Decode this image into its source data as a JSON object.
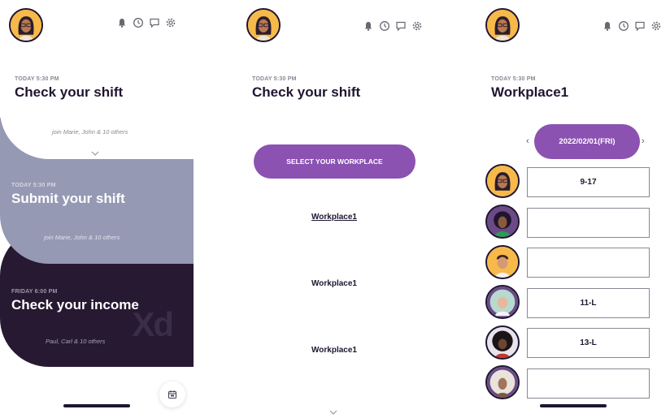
{
  "screen1": {
    "card1": {
      "kicker": "TODAY 5:30 PM",
      "title": "Check your shift",
      "sub": "join Marie, John & 10 others"
    },
    "card2": {
      "kicker": "TODAY 5:30 PM",
      "title": "Submit your shift",
      "sub": "join Marie, John & 10 others"
    },
    "card3": {
      "kicker": "FRIDAY 6:00 PM",
      "title": "Check your income",
      "sub": "Paul, Carl & 10 others",
      "watermark": "Xd"
    }
  },
  "screen2": {
    "kicker": "TODAY 5:30 PM",
    "title": "Check your shift",
    "select_button": "SELECT YOUR WORKPLACE",
    "workplaces": [
      "Workplace1",
      "Workplace1",
      "Workplace1"
    ]
  },
  "screen3": {
    "kicker": "TODAY 5:30 PM",
    "title": "Workplace1",
    "date": "2022/02/01(FRI)",
    "prev": "‹",
    "next": "›",
    "rows": [
      {
        "avatar_color": "#f6b94a",
        "shift": "9-17"
      },
      {
        "avatar_color": "#6b4b86",
        "shift": ""
      },
      {
        "avatar_color": "#f6b94a",
        "shift": ""
      },
      {
        "avatar_color": "#b7d9d0",
        "shift": "11-L"
      },
      {
        "avatar_color": "#6b4b86",
        "shift": "13-L"
      },
      {
        "avatar_color": "#b7d9d0",
        "shift": ""
      }
    ]
  },
  "colors": {
    "accent": "#8b52b2",
    "dark": "#271932",
    "mid": "#9599b3"
  },
  "icons": [
    "bell-icon",
    "clock-icon",
    "chat-icon",
    "gear-icon",
    "calendar-icon",
    "chevron-down-icon"
  ]
}
